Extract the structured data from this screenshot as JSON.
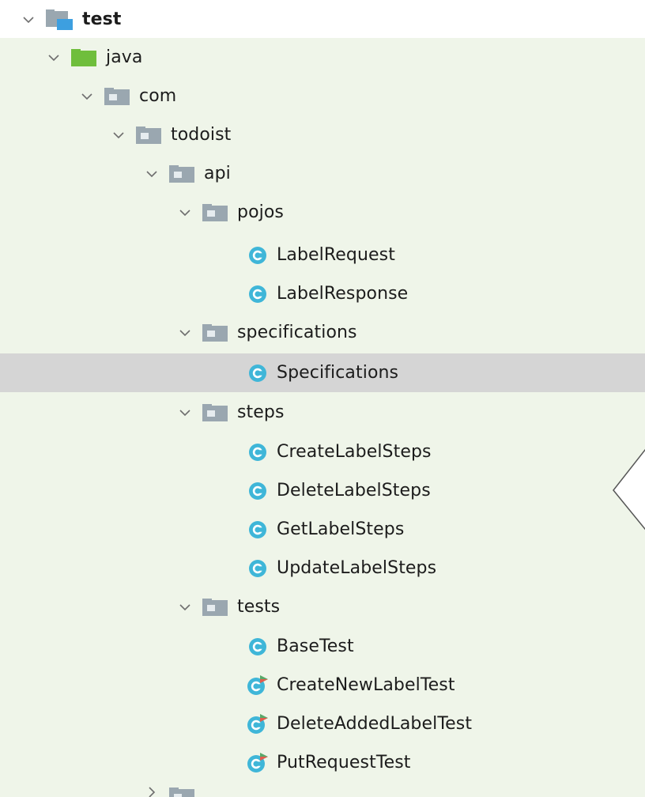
{
  "tree": {
    "root": {
      "label": "test"
    },
    "java": {
      "label": "java"
    },
    "com": {
      "label": "com"
    },
    "todoist": {
      "label": "todoist"
    },
    "api": {
      "label": "api"
    },
    "pojos": {
      "label": "pojos",
      "children": [
        "LabelRequest",
        "LabelResponse"
      ]
    },
    "specifications": {
      "label": "specifications",
      "children": [
        "Specifications"
      ]
    },
    "steps": {
      "label": "steps",
      "children": [
        "CreateLabelSteps",
        "DeleteLabelSteps",
        "GetLabelSteps",
        "UpdateLabelSteps"
      ]
    },
    "tests": {
      "label": "tests",
      "children": [
        "BaseTest",
        "CreateNewLabelTest",
        "DeleteAddedLabelTest",
        "PutRequestTest"
      ]
    },
    "cut_off_folder": {
      "label": "..."
    }
  },
  "selected_item": "Specifications",
  "colors": {
    "source_root_bg": "#eff5e9",
    "selection_bg": "#d5d5d5",
    "class_icon": "#3fb6d8",
    "folder_gray": "#9aa7b0",
    "folder_green": "#6fbe3c",
    "test_root_blue": "#3d9fe0",
    "run_marker_green": "#59a869",
    "run_marker_red": "#e35b4e"
  }
}
